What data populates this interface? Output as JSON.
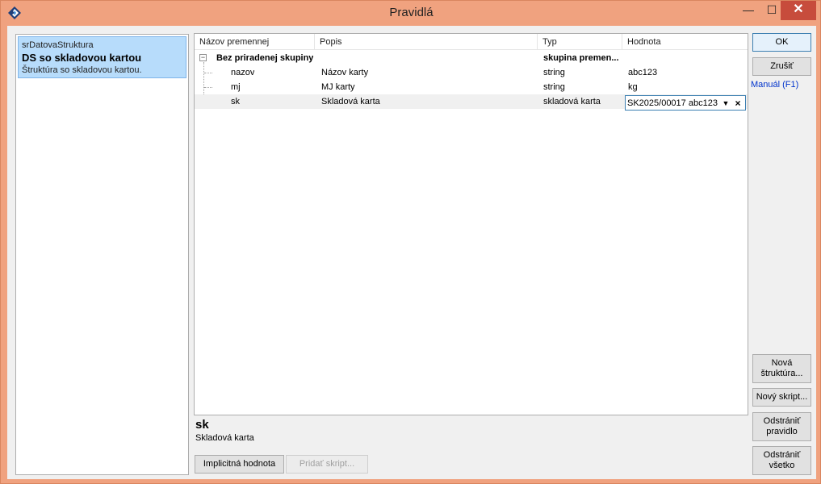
{
  "window": {
    "title": "Pravidlá",
    "controls": {
      "minimize": "—",
      "maximize": "☐",
      "close": "✕"
    }
  },
  "left_list": {
    "items": [
      {
        "name": "srDatovaStruktura",
        "title": "DS so skladovou kartou",
        "description": "Štruktúra so skladovou kartou."
      }
    ]
  },
  "grid": {
    "columns": [
      "Názov premennej",
      "Popis",
      "Typ",
      "Hodnota"
    ],
    "group": {
      "name": "Bez priradenej skupiny",
      "type": "skupina premen...",
      "expander": "−"
    },
    "rows": [
      {
        "name": "nazov",
        "description": "Názov karty",
        "type": "string",
        "value": "abc123"
      },
      {
        "name": "mj",
        "description": "MJ karty",
        "type": "string",
        "value": "kg"
      },
      {
        "name": "sk",
        "description": "Skladová karta",
        "type": "skladová karta",
        "value": "SK2025/00017 abc123"
      }
    ],
    "editor": {
      "dropdown_icon": "▼",
      "clear_icon": "×"
    }
  },
  "detail": {
    "name": "sk",
    "description": "Skladová karta"
  },
  "buttons": {
    "ok": "OK",
    "cancel": "Zrušiť",
    "manual_link": "Manuál (F1)",
    "new_structure": "Nová štruktúra...",
    "new_script": "Nový skript...",
    "remove_rule": "Odstrániť pravidlo",
    "remove_all": "Odstrániť všetko",
    "default_value": "Implicitná hodnota",
    "add_script": "Pridať skript..."
  }
}
